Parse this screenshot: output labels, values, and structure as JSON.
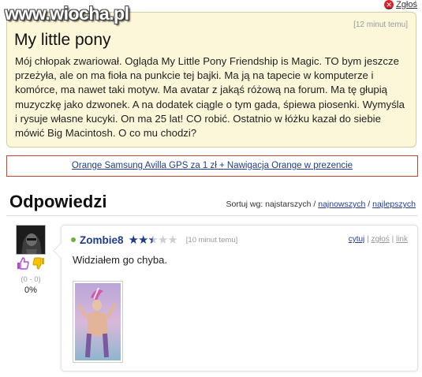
{
  "watermark": "www.wiocha.pl",
  "report": {
    "label": "Zgłoś"
  },
  "question": {
    "time": "[12 minut temu]",
    "title": "My little pony",
    "body": "Mój chłopak zwariował. Ogląda My Little Pony Friendship is Magic. TO bym jeszcze przeżyła, ale on ma fioła na punkcie tej bajki. Ma ją na tapecie w komputerze i komórce, ma nawet taki motyw. Ma avatar z jakąś różową na forum. Ma tę głupią muzyczkę jako dzwonek. A na dodatek ciągle o tym gada, śpiewa piosenki. Wymyśla i rysuje własne kucyki. On ma 25 lat! CO robić. Ostatnio w łóżku kazał do siebie mówić Big Macintosh. O co mu chodzi?"
  },
  "ad": {
    "text": "Orange Samsung Avilla GPS za 1 zł + Nawigacja Orange w prezencie"
  },
  "answers": {
    "title": "Odpowiedzi",
    "sort_label": "Sortuj wg: najstarszych /",
    "sort_newest": "najnowszych",
    "sort_sep": "/",
    "sort_best": "najlepszych"
  },
  "comment": {
    "author": "Zombie8",
    "rating": 2.5,
    "rating_max": 5,
    "time": "[10 minut temu]",
    "action_quote": "cytuj",
    "action_sep1": "|",
    "action_report": "zgłoś",
    "action_sep2": "|",
    "action_link": "link",
    "body": "Widziałem go chyba.",
    "votes_counts": "(0 - 0)",
    "votes_pct": "0%"
  },
  "colors": {
    "question_bg": "#fcf7d9",
    "link": "#1f3d8a",
    "ad_border": "#c8432b",
    "report_icon": "#d8232a"
  },
  "icons": [
    "close-icon",
    "thumbs-up-icon",
    "thumbs-down-icon",
    "star-icon",
    "online-status-icon"
  ]
}
